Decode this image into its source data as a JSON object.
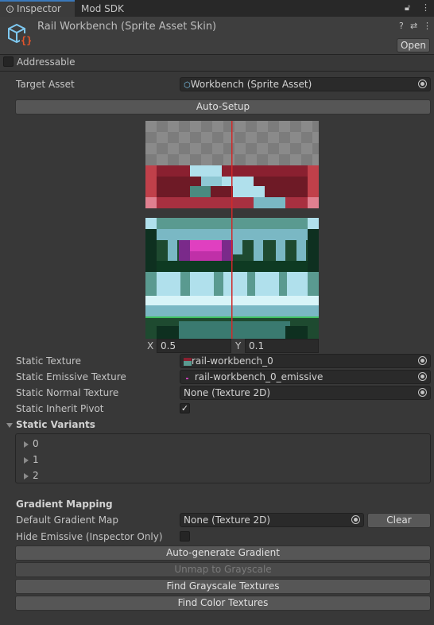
{
  "tabs": {
    "inspector": "Inspector",
    "mod_sdk": "Mod SDK"
  },
  "header": {
    "title": "Rail Workbench (Sprite Asset Skin)",
    "open_label": "Open"
  },
  "addressable": {
    "label": "Addressable",
    "checked": false
  },
  "target_asset": {
    "label": "Target Asset",
    "value": "Workbench (Sprite Asset)"
  },
  "auto_setup_label": "Auto-Setup",
  "pivot": {
    "x_label": "X",
    "x_value": "0.5",
    "y_label": "Y",
    "y_value": "0.1"
  },
  "static_texture": {
    "label": "Static Texture",
    "value": "rail-workbench_0"
  },
  "static_emissive": {
    "label": "Static Emissive Texture",
    "value": "rail-workbench_0_emissive"
  },
  "static_normal": {
    "label": "Static Normal Texture",
    "value": "None (Texture 2D)"
  },
  "static_inherit_pivot": {
    "label": "Static Inherit Pivot",
    "checked": true
  },
  "static_variants": {
    "label": "Static Variants",
    "items": [
      "0",
      "1",
      "2"
    ]
  },
  "gradient": {
    "heading": "Gradient Mapping",
    "default_map_label": "Default Gradient Map",
    "default_map_value": "None (Texture 2D)",
    "clear_label": "Clear",
    "hide_emissive_label": "Hide Emissive (Inspector Only)",
    "hide_emissive_checked": false
  },
  "buttons": {
    "auto_generate": "Auto-generate Gradient",
    "unmap": "Unmap to Grayscale",
    "find_grayscale": "Find Grayscale Textures",
    "find_color": "Find Color Textures"
  },
  "colors": {
    "accent": "#3a79bb",
    "pivot_line": "#d02a2a",
    "background": "#383838"
  }
}
